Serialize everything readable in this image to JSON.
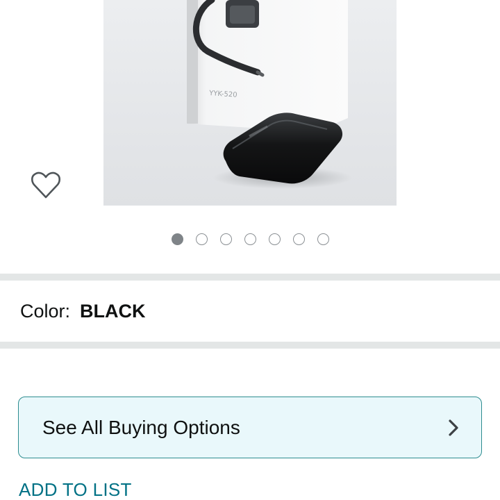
{
  "product": {
    "gallery": {
      "slide_count": 7,
      "active_slide_index": 0,
      "box_print_text": "YYK-520"
    },
    "icons": {
      "wishlist": "heart-outline-icon",
      "buying_options_arrow": "chevron-right-icon"
    },
    "color": {
      "label": "Color:",
      "value": "BLACK"
    },
    "buying_options": {
      "label": "See All Buying Options"
    },
    "add_to_list": {
      "label": "ADD TO LIST"
    }
  },
  "colors": {
    "link": "#007185",
    "card_border": "#2c8c8f",
    "card_background": "#e9f8fb",
    "divider": "#e3e6e6",
    "active_dot": "#7f8488"
  }
}
